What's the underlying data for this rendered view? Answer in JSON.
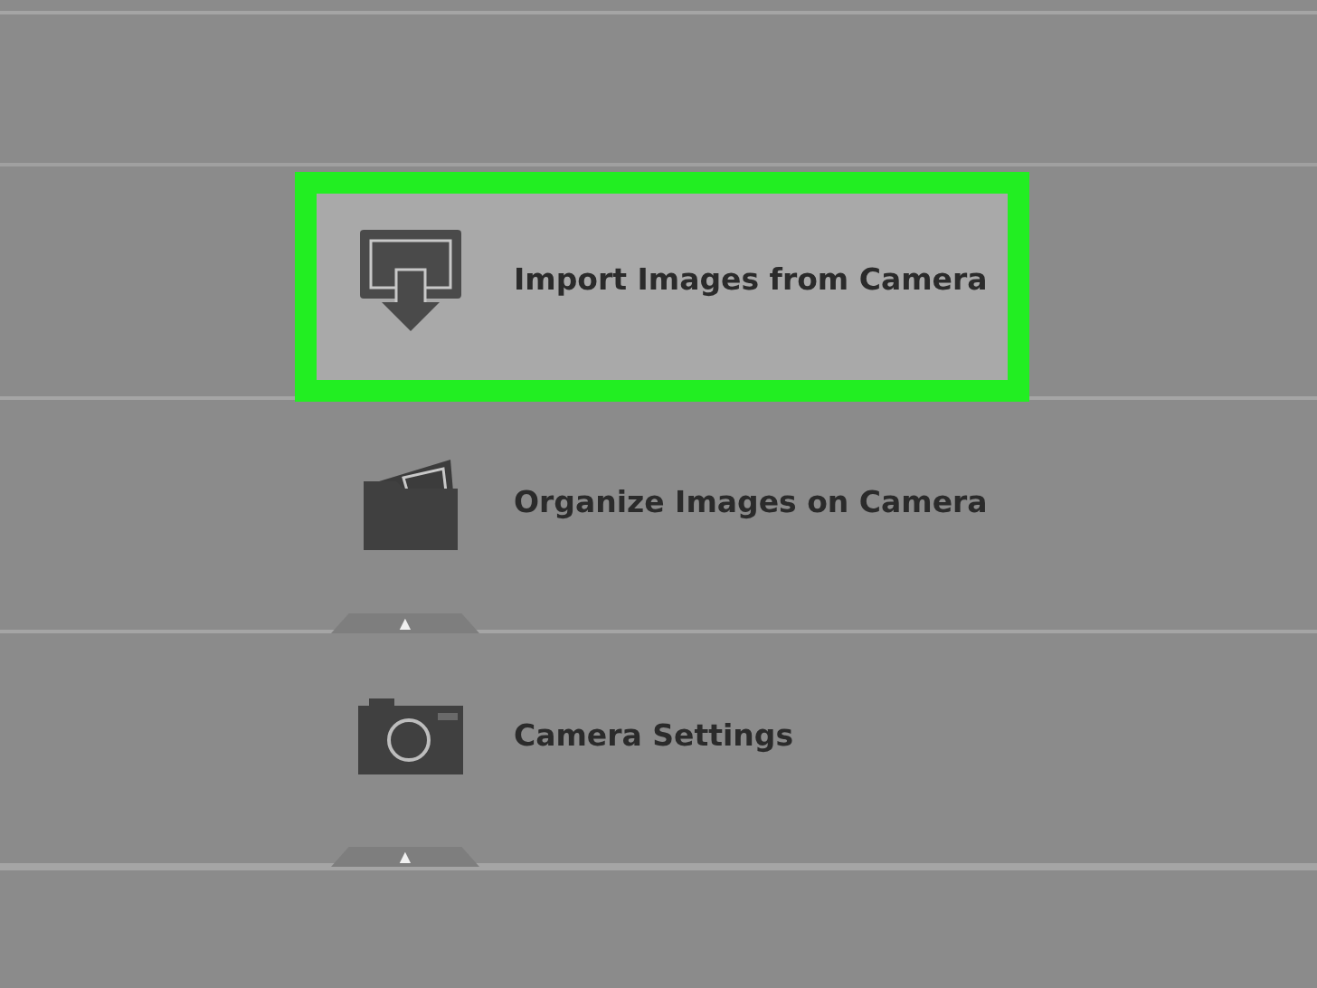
{
  "items": [
    {
      "kind": "import",
      "label": "Import Images from Camera",
      "selected": true
    },
    {
      "kind": "organize",
      "label": "Organize Images on Camera",
      "selected": false,
      "toggle": "▲"
    },
    {
      "kind": "settings",
      "label": "Camera Settings",
      "selected": false,
      "toggle": "▲"
    }
  ]
}
